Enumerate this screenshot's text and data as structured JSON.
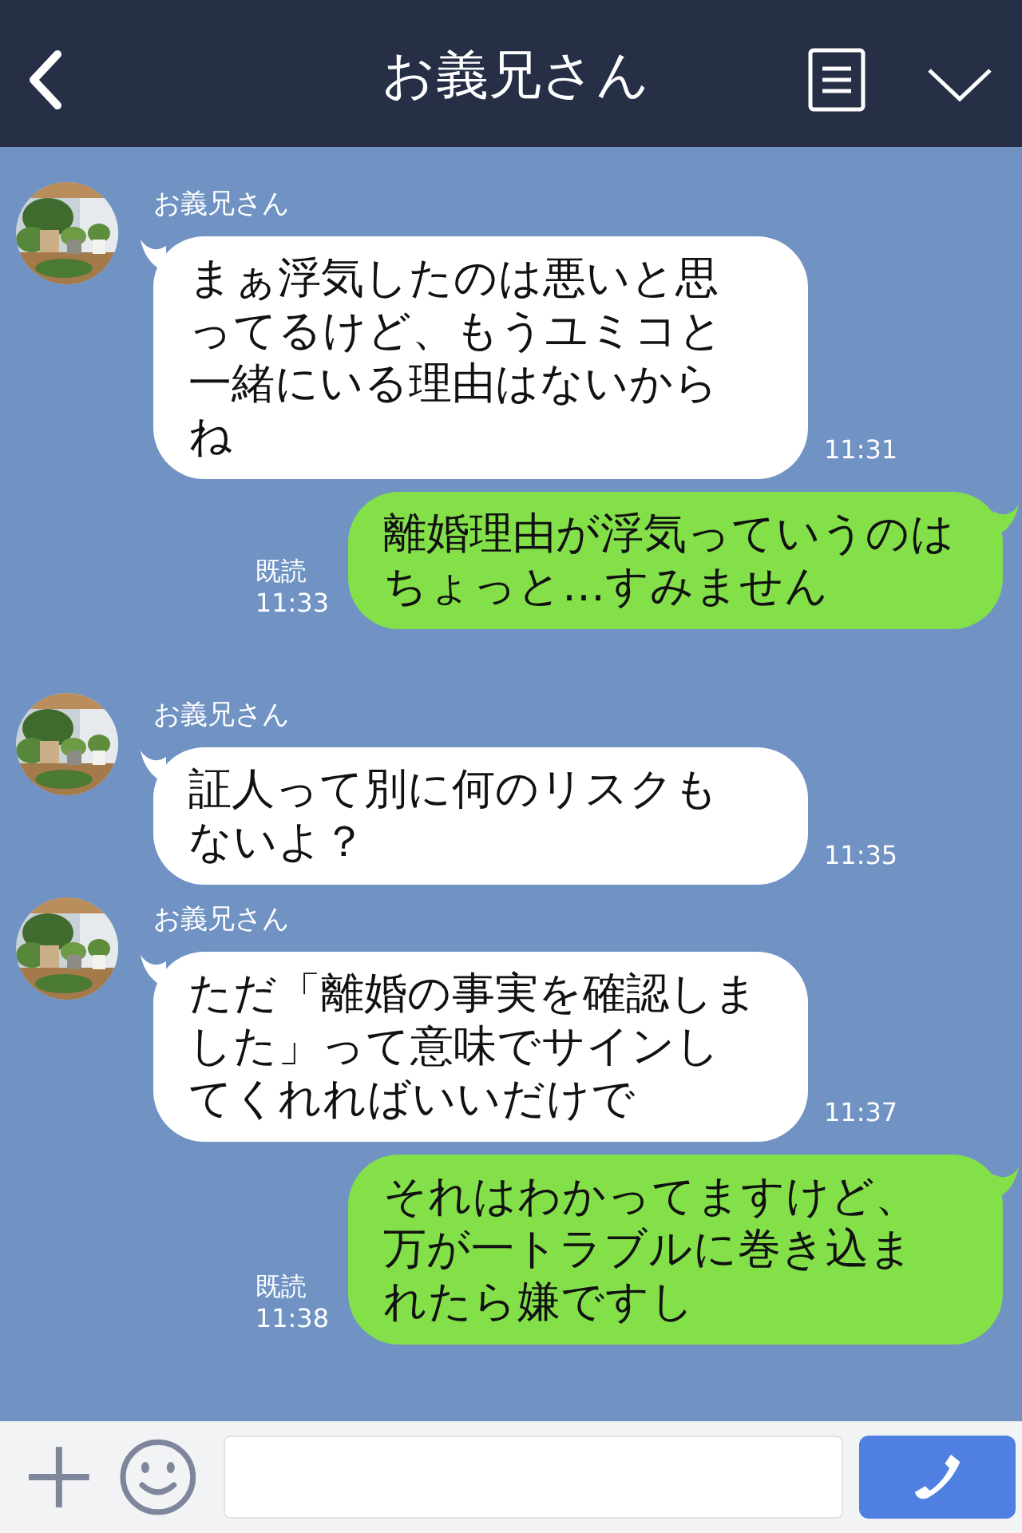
{
  "header": {
    "title": "お義兄さん"
  },
  "messages": [
    {
      "kind": "received",
      "sender": "お義兄さん",
      "text": "まぁ浮気したのは悪いと思ってるけど、もうユミコと一緒にいる理由はないからね",
      "time": "11:31"
    },
    {
      "kind": "sent",
      "read": "既読",
      "text": "離婚理由が浮気っていうのはちょっと…すみません",
      "time": "11:33"
    },
    {
      "kind": "received",
      "sender": "お義兄さん",
      "text": "証人って別に何のリスクもないよ？",
      "time": "11:35"
    },
    {
      "kind": "received",
      "sender": "お義兄さん",
      "text": "ただ「離婚の事実を確認しました」って意味でサインしてくれればいいだけで",
      "time": "11:37"
    },
    {
      "kind": "sent",
      "read": "既読",
      "text": "それはわかってますけど、万が一トラブルに巻き込まれたら嫌ですし",
      "time": "11:38"
    }
  ]
}
